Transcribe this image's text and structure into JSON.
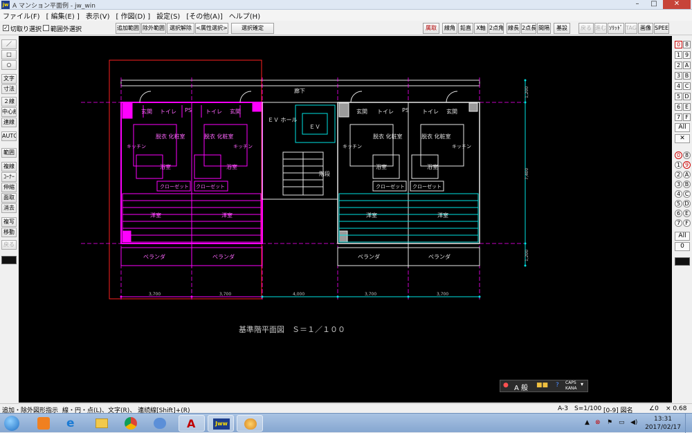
{
  "window": {
    "title": "A マンション平面例 - jw_win",
    "app_icon": "jw"
  },
  "menu": [
    "ファイル(F)",
    "[ 編集(E) ]",
    "表示(V)",
    "[ 作図(D) ]",
    "設定(S)",
    "[その他(A)]",
    "ヘルプ(H)"
  ],
  "toolbar": {
    "check1": "切取り選択",
    "check1_state": "✓",
    "check2": "範囲外選択",
    "buttons": [
      "追加範囲",
      "除外範囲",
      "選択解除",
      "<属性選択>",
      "選択確定"
    ],
    "right_buttons": [
      "属取",
      "線角",
      "鉛直",
      "X軸",
      "2点角",
      "線長",
      "2点長",
      "間隔",
      "基設",
      "戻る",
      "進む",
      "ｿﾘｯﾄﾞ",
      "TAG",
      "画像",
      "SPEED"
    ]
  },
  "left_tools": [
    "／",
    "□",
    "○",
    "文字",
    "寸法",
    "２線",
    "中心線",
    "連線",
    "AUTO",
    "範囲",
    "複線",
    "ｺｰﾅｰ",
    "伸縮",
    "面取",
    "消去",
    "複写",
    "移動",
    "戻る"
  ],
  "right_layers": {
    "group_a": [
      "0",
      "8",
      "1",
      "9",
      "2",
      "A",
      "3",
      "B",
      "4",
      "C",
      "5",
      "D",
      "6",
      "E",
      "7",
      "F"
    ],
    "all": "All",
    "group_b": [
      "0",
      "8",
      "1",
      "9",
      "2",
      "A",
      "3",
      "B",
      "4",
      "C",
      "5",
      "D",
      "6",
      "E",
      "7",
      "F"
    ],
    "all2": "All",
    "zero": "0"
  },
  "drawing": {
    "caption": "基準階平面図　Ｓ＝１／１００",
    "rooms": {
      "corridor": "廊下",
      "ev_hall": "ＥＶ ホール",
      "ev": "ＥＶ",
      "stairs": "階段",
      "entrance": "玄関",
      "toilet": "トイレ",
      "ps": "PS",
      "dressing": "脱衣 化粧室",
      "bath": "浴室",
      "kitchen": "キッチン",
      "closet": "クローゼット",
      "western_room": "洋室",
      "veranda": "ベランダ"
    },
    "dimensions": {
      "bottom": [
        "3,700",
        "3,700",
        "4,000",
        "3,700",
        "3,700"
      ],
      "right": [
        "1,200",
        "7,400",
        "1,200"
      ]
    }
  },
  "ime": {
    "mode": "A 般",
    "caps": "CAPS",
    "kana": "KANA"
  },
  "status": {
    "hint": "追加・除外図形指示",
    "mouse": "線・円・点(L)、文字(R)、 連続線[Shift]+(R)",
    "paper": "A-3",
    "scale": "S=1/100",
    "layer": "[0-9] 図名",
    "angle": "∠0",
    "factor": "× 0.68"
  },
  "taskbar": {
    "time": "13:31",
    "date": "2017/02/17"
  },
  "colors": {
    "canvas": "#000000",
    "magenta": "#ff00ff",
    "cyan": "#00e5e5",
    "white": "#e8e8e8",
    "red": "#ff2020"
  }
}
